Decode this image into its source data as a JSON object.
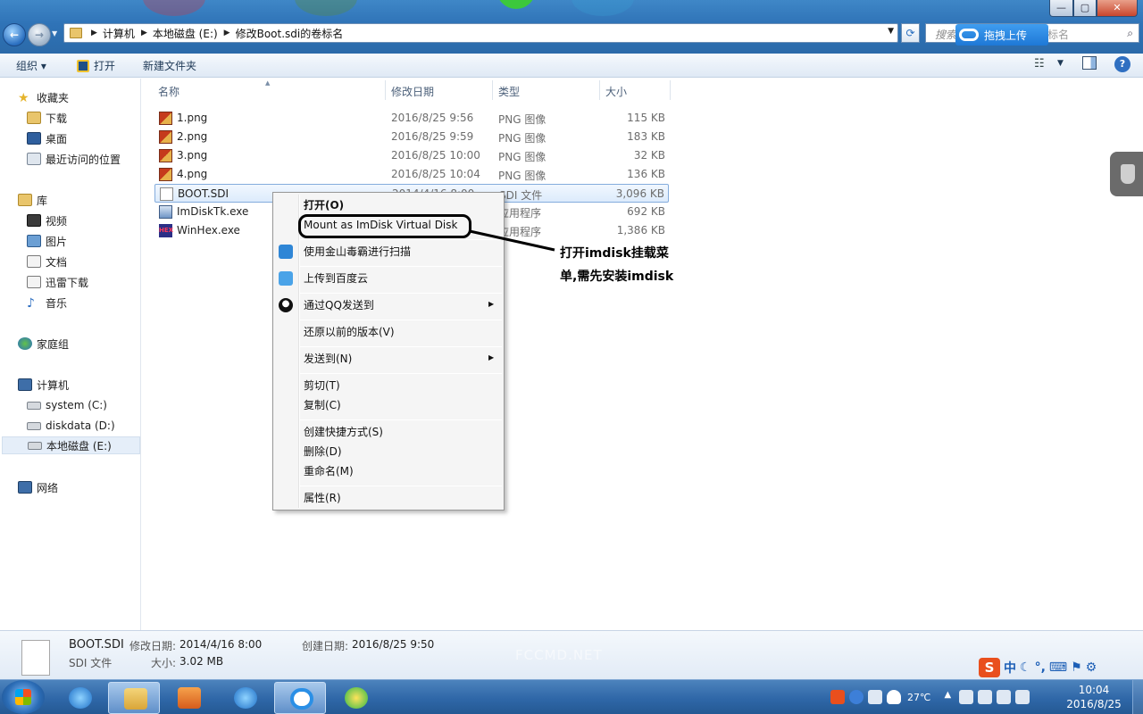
{
  "window": {
    "title_buttons": {
      "minimize": "—",
      "maximize": "▢",
      "close": "✕"
    }
  },
  "address_bar": {
    "crumbs": [
      "计算机",
      "本地磁盘 (E:)",
      "修改Boot.sdi的卷标名"
    ]
  },
  "search": {
    "placeholder_prefix": "搜索",
    "placeholder_suffix": "标名",
    "baidu_upload_label": "拖拽上传"
  },
  "toolbar": {
    "organize": "组织 ▾",
    "open": "打开",
    "new_folder": "新建文件夹"
  },
  "nav": {
    "favorites": "收藏夹",
    "favorites_items": [
      "下载",
      "桌面",
      "最近访问的位置"
    ],
    "libraries": "库",
    "library_items": [
      "视频",
      "图片",
      "文档",
      "迅雷下载",
      "音乐"
    ],
    "homegroup": "家庭组",
    "computer": "计算机",
    "drives": [
      "system (C:)",
      "diskdata (D:)",
      "本地磁盘 (E:)"
    ],
    "network": "网络"
  },
  "columns": {
    "name": "名称",
    "date": "修改日期",
    "type": "类型",
    "size": "大小"
  },
  "files": [
    {
      "name": "1.png",
      "date": "2016/8/25 9:56",
      "type": "PNG 图像",
      "size": "115 KB"
    },
    {
      "name": "2.png",
      "date": "2016/8/25 9:59",
      "type": "PNG 图像",
      "size": "183 KB"
    },
    {
      "name": "3.png",
      "date": "2016/8/25 10:00",
      "type": "PNG 图像",
      "size": "32 KB"
    },
    {
      "name": "4.png",
      "date": "2016/8/25 10:04",
      "type": "PNG 图像",
      "size": "136 KB"
    },
    {
      "name": "BOOT.SDI",
      "date": "2014/4/16 8:00",
      "type": "SDI 文件",
      "size": "3,096 KB"
    },
    {
      "name": "ImDiskTk.exe",
      "date": "",
      "type": "应用程序",
      "size": "692 KB"
    },
    {
      "name": "WinHex.exe",
      "date": "",
      "type": "应用程序",
      "size": "1,386 KB"
    }
  ],
  "context_menu": {
    "open": "打开(O)",
    "mount": "Mount as ImDisk Virtual Disk",
    "scan": "使用金山毒霸进行扫描",
    "baidu": "上传到百度云",
    "qq": "通过QQ发送到",
    "restore": "还原以前的版本(V)",
    "send_to": "发送到(N)",
    "cut": "剪切(T)",
    "copy": "复制(C)",
    "shortcut": "创建快捷方式(S)",
    "delete": "删除(D)",
    "rename": "重命名(M)",
    "properties": "属性(R)"
  },
  "annotation": {
    "line1": "打开imdisk挂载菜",
    "line2": "单,需先安装imdisk"
  },
  "details": {
    "file_name": "BOOT.SDI",
    "modified_label": "修改日期:",
    "modified_value": "2014/4/16 8:00",
    "created_label": "创建日期:",
    "created_value": "2016/8/25 9:50",
    "type_value": "SDI 文件",
    "size_label": "大小:",
    "size_value": "3.02 MB",
    "watermark": "FCCMD.NET"
  },
  "ime": {
    "logo": "S",
    "mode": "中"
  },
  "taskbar": {
    "temperature": "27℃",
    "time": "10:04",
    "date": "2016/8/25"
  }
}
